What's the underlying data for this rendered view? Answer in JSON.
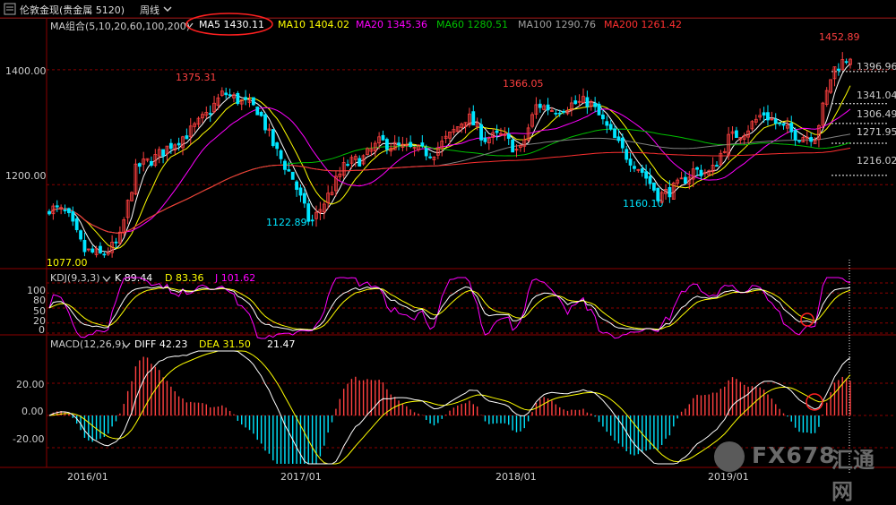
{
  "window": {
    "title": "伦敦金现(贵金属 5120)",
    "period": "周线"
  },
  "legends": {
    "ma": {
      "group": "MA组合(5,10,20,60,100,200)",
      "ma5": "MA5 1430.11",
      "ma10": "MA10 1404.02",
      "ma20": "MA20 1345.36",
      "ma60": "MA60 1280.51",
      "ma100": "MA100 1290.76",
      "ma200": "MA200 1261.42"
    },
    "kdj": {
      "name": "KDJ(9,3,3)",
      "k": "K 89.44",
      "d": "D 83.36",
      "j": "J 101.62"
    },
    "macd": {
      "name": "MACD(12,26,9)",
      "diff": "DIFF 42.23",
      "dea": "DEA 31.50",
      "hist": "21.47"
    }
  },
  "price_axis": {
    "left_ticks": [
      "1400.00",
      "1200.00"
    ],
    "right_labels": [
      "1396.96",
      "1341.04",
      "1306.49",
      "1271.95",
      "1216.02"
    ]
  },
  "kdj_axis": [
    "100",
    "80",
    "50",
    "20",
    "0"
  ],
  "macd_axis": [
    "20.00",
    "0.00",
    "-20.00"
  ],
  "time_axis": [
    "2016/01",
    "2017/01",
    "2018/01",
    "2019/01"
  ],
  "annotations": {
    "high_2016": "1375.31",
    "low_2016": "1122.89",
    "high_2018": "1366.05",
    "low_2018": "1160.10",
    "high_2019": "1452.89",
    "low_start": "1077.00"
  },
  "colors": {
    "up": "#ff4040",
    "down": "#00e5ff",
    "ma5": "#ffffff",
    "ma10": "#ffff00",
    "ma20": "#ff00ff",
    "ma60": "#00c000",
    "ma100": "#808080",
    "ma200": "#ff3030",
    "grid": "#8b0000",
    "highlight": "#ff2020"
  },
  "logo": {
    "text": "FX678",
    "cn": "汇通网"
  },
  "chart_data": {
    "type": "candlestick",
    "frequency": "weekly",
    "x_range": [
      "2015/08",
      "2019/07"
    ],
    "price": {
      "ylim": [
        1060,
        1470
      ],
      "ticks": [
        1200,
        1400
      ],
      "reference_levels": [
        1396.96,
        1341.04,
        1306.49,
        1271.95,
        1216.02
      ],
      "close_path": [
        [
          "2015-08",
          1160
        ],
        [
          "2015-10",
          1150
        ],
        [
          "2015-11",
          1085
        ],
        [
          "2015-12",
          1077
        ],
        [
          "2016-01",
          1100
        ],
        [
          "2016-02",
          1230
        ],
        [
          "2016-03",
          1245
        ],
        [
          "2016-04",
          1270
        ],
        [
          "2016-05",
          1290
        ],
        [
          "2016-06",
          1320
        ],
        [
          "2016-07",
          1360
        ],
        [
          "2016-08",
          1345
        ],
        [
          "2016-09",
          1330
        ],
        [
          "2016-10",
          1260
        ],
        [
          "2016-11",
          1210
        ],
        [
          "2016-12",
          1130
        ],
        [
          "2017-01",
          1180
        ],
        [
          "2017-02",
          1235
        ],
        [
          "2017-03",
          1245
        ],
        [
          "2017-04",
          1275
        ],
        [
          "2017-05",
          1265
        ],
        [
          "2017-06",
          1260
        ],
        [
          "2017-07",
          1255
        ],
        [
          "2017-08",
          1285
        ],
        [
          "2017-09",
          1320
        ],
        [
          "2017-10",
          1280
        ],
        [
          "2017-11",
          1285
        ],
        [
          "2017-12",
          1255
        ],
        [
          "2018-01",
          1340
        ],
        [
          "2018-02",
          1330
        ],
        [
          "2018-03",
          1340
        ],
        [
          "2018-04",
          1345
        ],
        [
          "2018-05",
          1300
        ],
        [
          "2018-06",
          1255
        ],
        [
          "2018-07",
          1225
        ],
        [
          "2018-08",
          1180
        ],
        [
          "2018-09",
          1195
        ],
        [
          "2018-10",
          1225
        ],
        [
          "2018-11",
          1220
        ],
        [
          "2018-12",
          1280
        ],
        [
          "2019-01",
          1295
        ],
        [
          "2019-02",
          1325
        ],
        [
          "2019-03",
          1300
        ],
        [
          "2019-04",
          1285
        ],
        [
          "2019-05",
          1285
        ],
        [
          "2019-06",
          1400
        ],
        [
          "2019-07",
          1425
        ]
      ],
      "annotated_highs": [
        1375.31,
        1366.05,
        1452.89
      ],
      "annotated_lows": [
        1122.89,
        1160.1
      ]
    },
    "moving_averages": {
      "MA5": 1430.11,
      "MA10": 1404.02,
      "MA20": 1345.36,
      "MA60": 1280.51,
      "MA100": 1290.76,
      "MA200": 1261.42
    },
    "kdj": {
      "ylim": [
        0,
        100
      ],
      "K": 89.44,
      "D": 83.36,
      "J": 101.62
    },
    "macd": {
      "ylim": [
        -30,
        40
      ],
      "DIFF": 42.23,
      "DEA": 31.5,
      "MACD": 21.47
    }
  }
}
